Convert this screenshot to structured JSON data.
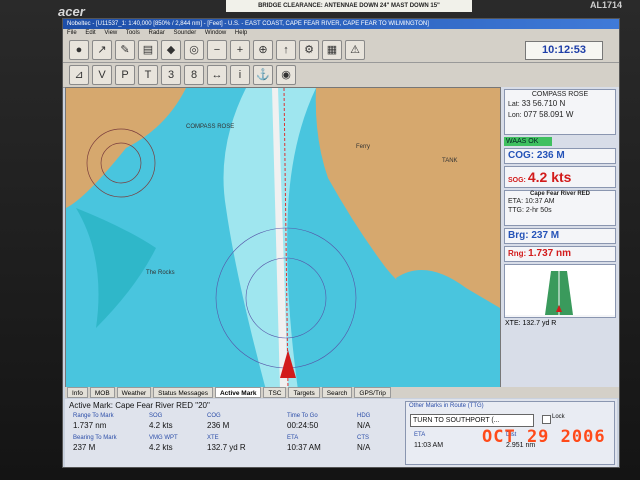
{
  "monitor": {
    "brand": "acer",
    "model": "AL1714",
    "sticker": "BRIDGE CLEARANCE: ANTENNAE DOWN 24\"   MAST DOWN 15\""
  },
  "app": {
    "title": "Nobeltec - [U11537_1: 1:40,000 [850% / 2,844 nm] - [Feet] - U.S. - EAST COAST, CAPE FEAR RIVER, CAPE FEAR TO WILMINGTON]",
    "menu": [
      "File",
      "Edit",
      "View",
      "Tools",
      "Radar",
      "Sounder",
      "Window",
      "Help"
    ],
    "clock": "10:12:53"
  },
  "chart_labels": {
    "compass_rose": "COMPASS ROSE",
    "ferry": "Ferry",
    "tank": "TANK",
    "the_rocks": "The Rocks"
  },
  "panel": {
    "compass_title": "COMPASS ROSE",
    "lat_label": "Lat:",
    "lat": "33 56.710 N",
    "lon_label": "Lon:",
    "lon": "077 58.091 W",
    "waas": "WAAS OK",
    "cog": "COG: 236 M",
    "sog_label": "SOG:",
    "sog": "4.2 kts",
    "mark_title": "Cape Fear River RED",
    "eta_label": "ETA:",
    "eta": "10:37 AM",
    "ttg_label": "TTG:",
    "ttg": "2-hr 50s",
    "brg": "Brg: 237 M",
    "rng_label": "Rng:",
    "rng": "1.737 nm",
    "xte": "XTE:  132.7 yd R"
  },
  "tabs": [
    "Info",
    "MOB",
    "Weather",
    "Status Messages",
    "Active Mark",
    "TSC",
    "Targets",
    "Search",
    "GPS/Trip"
  ],
  "bottom": {
    "active_mark": "Active Mark: Cape Fear River RED \"20\"",
    "range_lbl": "Range To Mark",
    "range": "1.737 nm",
    "sog_lbl": "SOG",
    "sog": "4.2 kts",
    "cog_lbl": "COG",
    "cog": "236 M",
    "ttg_lbl": "Time To Go",
    "ttg": "00:24:50",
    "hdg_lbl": "HDG",
    "hdg": "N/A",
    "brg_lbl": "Bearing To Mark",
    "brg": "237 M",
    "vmg_lbl": "VMG WPT",
    "vmg": "4.2 kts",
    "xte_lbl": "XTE",
    "xte": "132.7 yd R",
    "eta_lbl": "ETA",
    "eta": "10:37 AM",
    "cts_lbl": "CTS",
    "cts": "N/A",
    "route_title": "Other Marks in Route (TTG)",
    "route_select": "TURN TO SOUTHPORT (...",
    "lock": "Lock",
    "r_eta_lbl": "ETA",
    "r_eta": "11:03 AM",
    "r_dist_lbl": "Dist",
    "r_dist": "2.951 nm"
  },
  "photo_stamp": "OCT 29 2006"
}
